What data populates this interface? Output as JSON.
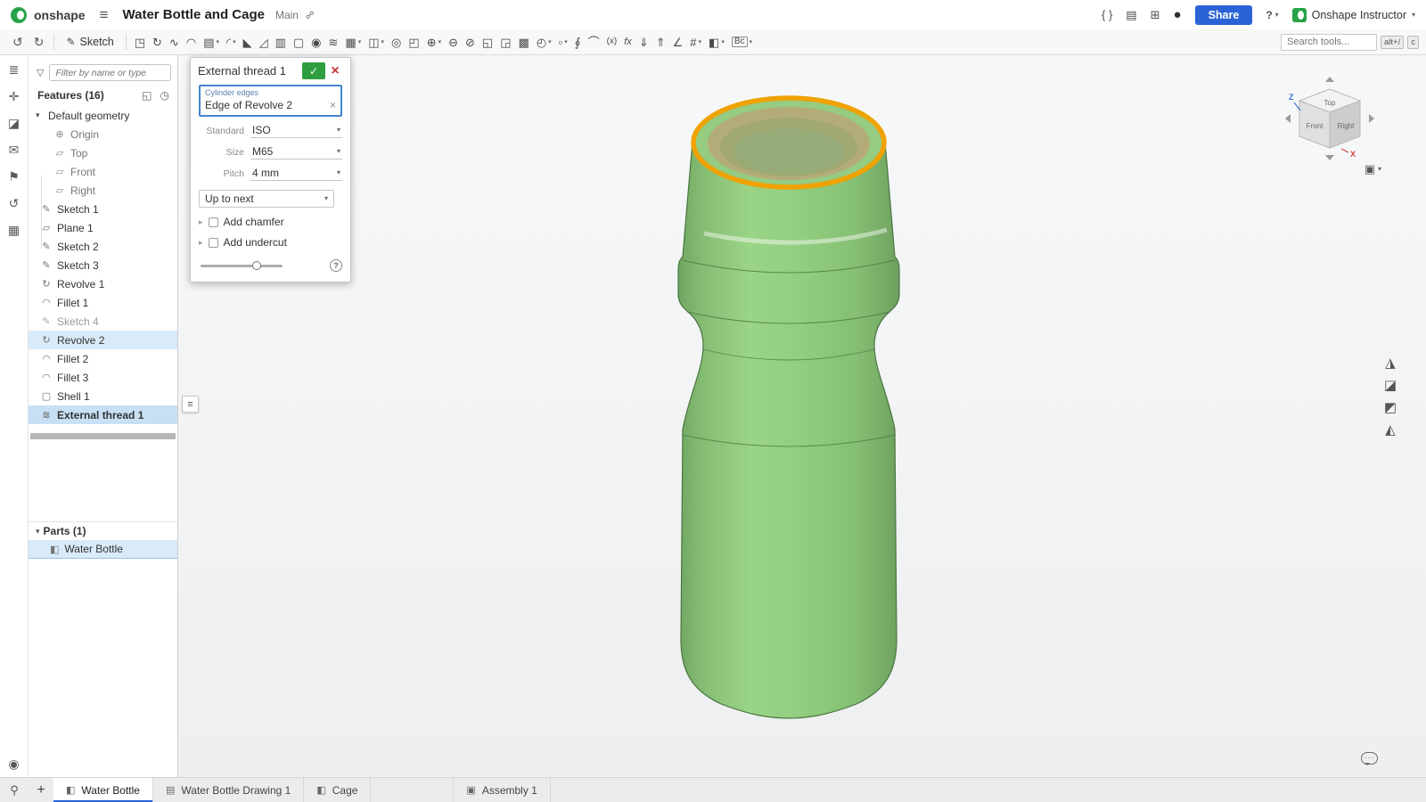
{
  "ui": {
    "caret": "▾",
    "chevron_down": "▾",
    "chevron_right": "▸"
  },
  "colors": {
    "accent_blue": "#2a63d6",
    "onshape_green": "#27a348",
    "bottle_green": "#8fcb7d",
    "selected_edge_orange": "#efa202",
    "selection_row_blue": "#d9eaf8"
  },
  "header": {
    "logo": "onshape",
    "menu_icon": "≡",
    "title": "Water Bottle and Cage",
    "branch": "Main",
    "link_icon": "⚯",
    "right_icons": [
      {
        "name": "featurescript-icon",
        "glyph": "{ }"
      },
      {
        "name": "panel-layout-icon",
        "glyph": "▤"
      },
      {
        "name": "app-store-icon",
        "glyph": "⊞"
      },
      {
        "name": "learning-center-icon",
        "glyph": "●"
      }
    ],
    "share_label": "Share",
    "help_icon": "?",
    "user_name": "Onshape Instructor"
  },
  "toolbar": {
    "undo_icon": "↺",
    "redo_icon": "↻",
    "sketch_icon": "✎",
    "sketch_label": "Sketch",
    "search_placeholder": "Search tools...",
    "shortcut_primary": "alt+/",
    "shortcut_secondary": "c",
    "icons": [
      {
        "name": "extrude-icon",
        "glyph": "◳"
      },
      {
        "name": "revolve-icon",
        "glyph": "↻"
      },
      {
        "name": "sweep-icon",
        "glyph": "∿"
      },
      {
        "name": "loft-icon",
        "glyph": "◠"
      },
      {
        "name": "thicken-icon",
        "glyph": "▤",
        "caret": true
      },
      {
        "name": "fillet-icon",
        "glyph": "◜",
        "caret": true
      },
      {
        "name": "chamfer-icon",
        "glyph": "◣"
      },
      {
        "name": "draft-icon",
        "glyph": "◿"
      },
      {
        "name": "rib-icon",
        "glyph": "▥"
      },
      {
        "name": "shell-icon",
        "glyph": "▢"
      },
      {
        "name": "hole-icon",
        "glyph": "◉"
      },
      {
        "name": "thread-icon",
        "glyph": "≋"
      },
      {
        "name": "linear-pattern-icon",
        "glyph": "▦",
        "caret": true
      },
      {
        "name": "mirror-icon",
        "glyph": "◫",
        "caret": true
      },
      {
        "name": "boolean-icon",
        "glyph": "◎"
      },
      {
        "name": "split-icon",
        "glyph": "◰"
      },
      {
        "name": "transform-icon",
        "glyph": "⊕",
        "caret": true
      },
      {
        "name": "offset-surface-icon",
        "glyph": "⊖"
      },
      {
        "name": "delete-face-icon",
        "glyph": "⊘"
      },
      {
        "name": "move-face-icon",
        "glyph": "◱"
      },
      {
        "name": "replace-face-icon",
        "glyph": "◲"
      },
      {
        "name": "fill-surface-icon",
        "glyph": "▩"
      },
      {
        "name": "boundary-surface-icon",
        "glyph": "◴",
        "caret": true
      },
      {
        "name": "enclose-icon",
        "glyph": "▫",
        "caret": true
      },
      {
        "name": "helix-icon",
        "glyph": "∮"
      },
      {
        "name": "projected-curve-icon",
        "glyph": "⌒"
      },
      {
        "name": "variable-icon",
        "glyph": "(x)"
      },
      {
        "name": "variable-studio-icon",
        "glyph": "fx"
      },
      {
        "name": "import-icon",
        "glyph": "⇓"
      },
      {
        "name": "derived-icon",
        "glyph": "⇑"
      },
      {
        "name": "measure-icon",
        "glyph": "∠"
      },
      {
        "name": "sheet-metal-icon",
        "glyph": "#",
        "caret": true
      },
      {
        "name": "appearance-icon",
        "glyph": "◧",
        "caret": true
      },
      {
        "name": "custom-feature-icon",
        "glyph": "Bc",
        "caret": true
      }
    ]
  },
  "left_rail": {
    "icons": [
      {
        "name": "feature-list-icon",
        "glyph": "≣"
      },
      {
        "name": "configurations-icon",
        "glyph": "✛"
      },
      {
        "name": "appearance-panel-icon",
        "glyph": "◪"
      },
      {
        "name": "comments-icon",
        "glyph": "✉"
      },
      {
        "name": "publications-icon",
        "glyph": "⚑"
      },
      {
        "name": "versions-history-icon",
        "glyph": "↺"
      },
      {
        "name": "tables-icon",
        "glyph": "▦"
      }
    ],
    "bottom_icon": {
      "name": "zoom-tools-icon",
      "glyph": "◉"
    }
  },
  "feature_panel": {
    "filter_icon": "▽",
    "filter_placeholder": "Filter by name or type",
    "features_header": "Features (16)",
    "header_icons": [
      {
        "name": "open-in-window-icon",
        "glyph": "◱"
      },
      {
        "name": "history-icon",
        "glyph": "◷"
      }
    ],
    "tree": [
      {
        "glyph": "",
        "label": "Default geometry"
      },
      {
        "glyph": "⊕",
        "label": "Origin"
      },
      {
        "glyph": "▱",
        "label": "Top"
      },
      {
        "glyph": "▱",
        "label": "Front"
      },
      {
        "glyph": "▱",
        "label": "Right"
      },
      {
        "glyph": "✎",
        "label": "Sketch 1"
      },
      {
        "glyph": "▱",
        "label": "Plane 1"
      },
      {
        "glyph": "✎",
        "label": "Sketch 2"
      },
      {
        "glyph": "✎",
        "label": "Sketch 3"
      },
      {
        "glyph": "↻",
        "label": "Revolve 1"
      },
      {
        "glyph": "◠",
        "label": "Fillet 1"
      },
      {
        "glyph": "✎",
        "label": "Sketch 4"
      },
      {
        "glyph": "↻",
        "label": "Revolve 2"
      },
      {
        "glyph": "◠",
        "label": "Fillet 2"
      },
      {
        "glyph": "◠",
        "label": "Fillet 3"
      },
      {
        "glyph": "▢",
        "label": "Shell 1"
      },
      {
        "glyph": "≋",
        "label": "External thread 1"
      }
    ],
    "parts_header": "Parts (1)",
    "parts": [
      {
        "glyph": "◧",
        "label": "Water Bottle"
      }
    ],
    "popout_icon": "≡"
  },
  "dialog": {
    "title": "External thread 1",
    "confirm_icon": "✓",
    "close_icon": "×",
    "selection_label": "Cylinder edges",
    "selection_value": "Edge of Revolve 2",
    "remove_icon": "×",
    "params": [
      {
        "label": "Standard",
        "value": "ISO"
      },
      {
        "label": "Size",
        "value": "M65"
      },
      {
        "label": "Pitch",
        "value": "4 mm"
      }
    ],
    "termination": "Up to next",
    "options": [
      {
        "label": "Add chamfer"
      },
      {
        "label": "Add undercut"
      }
    ],
    "help_icon": "?"
  },
  "viewport": {
    "view_cube": {
      "top": "Top",
      "front": "Front",
      "right": "Right"
    },
    "axes": {
      "z": "Z",
      "x": "X"
    },
    "home_icon": "▣",
    "right_tools": [
      {
        "name": "view-tools-icon",
        "glyph": "◮"
      },
      {
        "name": "section-view-icon",
        "glyph": "◪"
      },
      {
        "name": "hidden-edges-icon",
        "glyph": "◩"
      },
      {
        "name": "named-views-icon",
        "glyph": "◭"
      }
    ],
    "chat_dots": "···"
  },
  "tabs": {
    "search_icon": "⚲",
    "add_icon": "+",
    "items": [
      {
        "glyph": "◧",
        "label": "Water Bottle",
        "active": true
      },
      {
        "glyph": "▤",
        "label": "Water Bottle Drawing 1"
      },
      {
        "glyph": "◧",
        "label": "Cage"
      },
      {
        "glyph": "▣",
        "label": "Assembly 1"
      }
    ]
  }
}
